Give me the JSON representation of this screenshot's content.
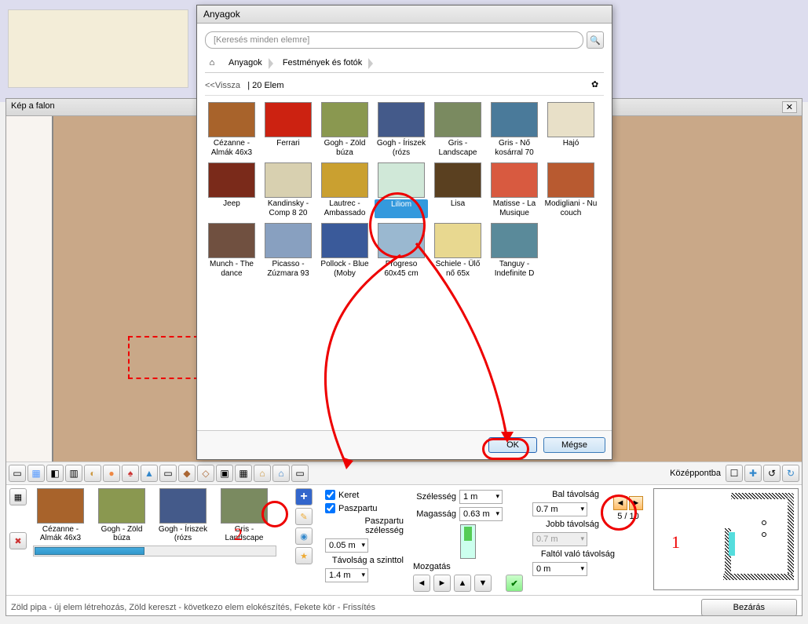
{
  "main": {
    "title": "Kép a falon"
  },
  "dialog": {
    "title": "Anyagok",
    "search_placeholder": "[Keresés minden elemre]",
    "bc_home": "Anyagok",
    "bc_cat": "Festmények és fotók",
    "back": "<<Vissza",
    "count": "| 20 Elem",
    "ok": "OK",
    "cancel": "Mégse",
    "items": [
      {
        "label": "Cézanne - Almák 46x3",
        "c": "#a8632b"
      },
      {
        "label": "Ferrari",
        "c": "#c21"
      },
      {
        "label": "Gogh - Zöld búza",
        "c": "#8a9850"
      },
      {
        "label": "Gogh - Íriszek (rózs",
        "c": "#445a8a"
      },
      {
        "label": "Gris - Landscape",
        "c": "#7a8a60"
      },
      {
        "label": "Gris - Nő kosárral 70",
        "c": "#4a7a9a"
      },
      {
        "label": "Hajó",
        "c": "#e8e0c8"
      },
      {
        "label": "Jeep",
        "c": "#7a2a1a"
      },
      {
        "label": "Kandinsky - Comp 8 20",
        "c": "#d8d0b0"
      },
      {
        "label": "Lautrec - Ambassado",
        "c": "#caa030"
      },
      {
        "label": "Liliom",
        "c": "#d0e8d8",
        "sel": true
      },
      {
        "label": "Lisa",
        "c": "#5a4020"
      },
      {
        "label": "Matisse - La Musique",
        "c": "#d85a40"
      },
      {
        "label": "Modigliani - Nu couch",
        "c": "#b85a30"
      },
      {
        "label": "Munch - The dance",
        "c": "#705040"
      },
      {
        "label": "Picasso - Zúzmara 93",
        "c": "#88a0c0"
      },
      {
        "label": "Pollock - Blue (Moby",
        "c": "#3a5a9a"
      },
      {
        "label": "Progreso 60x45 cm",
        "c": "#9ab8d0"
      },
      {
        "label": "Schiele - Ülő nő 65x",
        "c": "#e8d890"
      },
      {
        "label": "Tanguy - Indefinite D",
        "c": "#5a8a9a"
      }
    ]
  },
  "thumbs": [
    {
      "label": "Cézanne - Almák 46x3",
      "c": "#a8632b"
    },
    {
      "label": "Gogh - Zöld búza",
      "c": "#8a9850"
    },
    {
      "label": "Gogh - Íriszek (rózs",
      "c": "#445a8a"
    },
    {
      "label": "Gris - Landscape",
      "c": "#7a8a60"
    }
  ],
  "controls": {
    "keret": "Keret",
    "paszpartu": "Paszpartu",
    "psz_width_lbl": "Paszpartu szélesség",
    "psz_width": "0.05 m",
    "dist_lbl": "Távolság a szinttol",
    "dist": "1.4 m",
    "width_lbl": "Szélesség",
    "width": "1 m",
    "height_lbl": "Magasság",
    "height": "0.63 m",
    "move_lbl": "Mozgatás",
    "center_lbl": "Középpontba",
    "left_lbl": "Bal távolság",
    "left": "0.7 m",
    "right_lbl": "Jobb távolság",
    "right": "0.7 m",
    "wall_lbl": "Faltól való távolság",
    "wall": "0 m",
    "pager": "5 / 10"
  },
  "status": "Zöld pipa - új elem létrehozás, Zöld kereszt - következo elem elokészítés, Fekete kör - Frissítés",
  "close": "Bezárás",
  "annotation": {
    "n1": "1",
    "n2": "2"
  }
}
